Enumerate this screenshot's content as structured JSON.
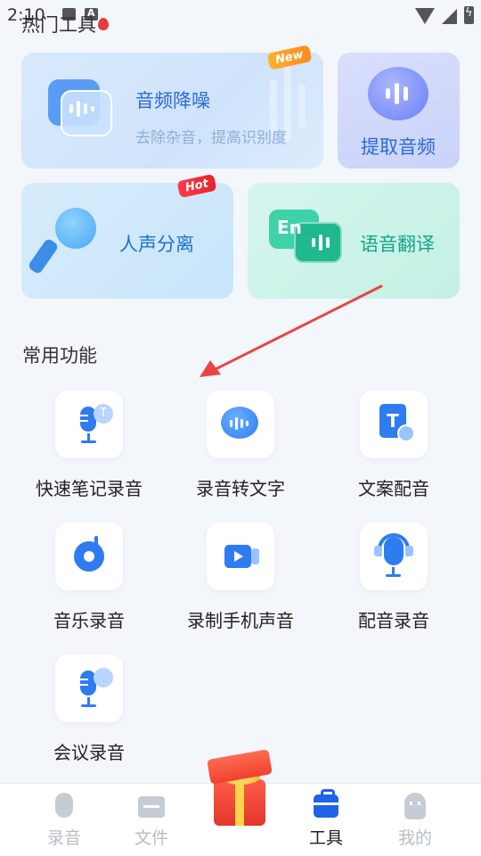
{
  "status_bar": {
    "time": "2:10"
  },
  "hot_section": {
    "title": "热门工具"
  },
  "cards": {
    "denoise": {
      "title": "音频降噪",
      "subtitle": "去除杂音，提高识别度",
      "badge": "New"
    },
    "extract": {
      "title": "提取音频"
    },
    "vocal": {
      "title": "人声分离",
      "badge": "Hot"
    },
    "translate": {
      "title": "语音翻译",
      "icon_text": "En"
    }
  },
  "common_section": {
    "title": "常用功能"
  },
  "functions": [
    {
      "label": "快速笔记录音",
      "icon": "mic-text-icon"
    },
    {
      "label": "录音转文字",
      "icon": "speech-bubble-icon"
    },
    {
      "label": "文案配音",
      "icon": "document-audio-icon",
      "icon_text": "T"
    },
    {
      "label": "音乐录音",
      "icon": "music-disc-icon"
    },
    {
      "label": "录制手机声音",
      "icon": "video-record-icon"
    },
    {
      "label": "配音录音",
      "icon": "headset-mic-icon"
    },
    {
      "label": "会议录音",
      "icon": "mic-wave-icon"
    }
  ],
  "bottom_nav": [
    {
      "label": "录音",
      "icon": "mic-icon",
      "active": false
    },
    {
      "label": "文件",
      "icon": "folder-icon",
      "active": false
    },
    {
      "label": "工具",
      "icon": "toolbox-icon",
      "active": true
    },
    {
      "label": "我的",
      "icon": "profile-icon",
      "active": false
    }
  ],
  "colors": {
    "accent": "#2f7bf0",
    "nav_active": "#1f63e6",
    "nav_inactive": "#b7bdc7",
    "translate_green": "#13a58a",
    "annotation_arrow": "#e84545"
  }
}
